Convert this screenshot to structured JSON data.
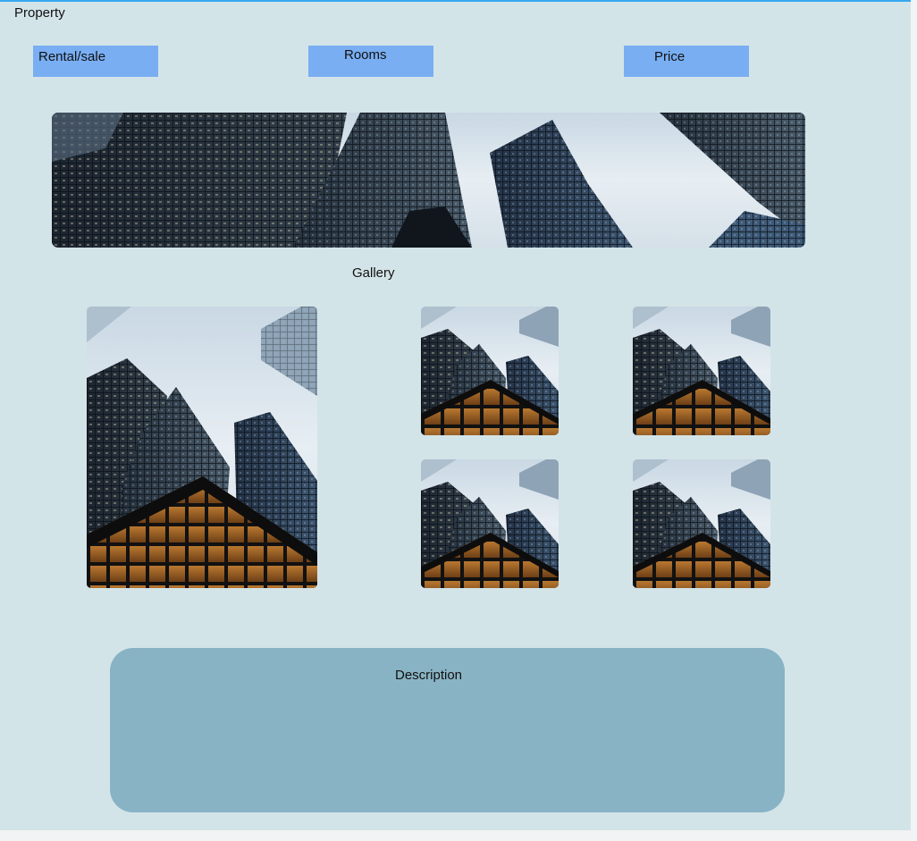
{
  "header": {
    "title": "Property"
  },
  "filters": {
    "rental_sale_label": "Rental/sale",
    "rooms_label": "Rooms",
    "price_label": "Price",
    "button_color": "#79aef2"
  },
  "gallery": {
    "title": "Gallery",
    "photo_count": 5
  },
  "description": {
    "label": "Description",
    "panel_color": "#88b3c4"
  },
  "colors": {
    "background": "#d3e4e8",
    "accent_top_border": "#35a8f0"
  }
}
